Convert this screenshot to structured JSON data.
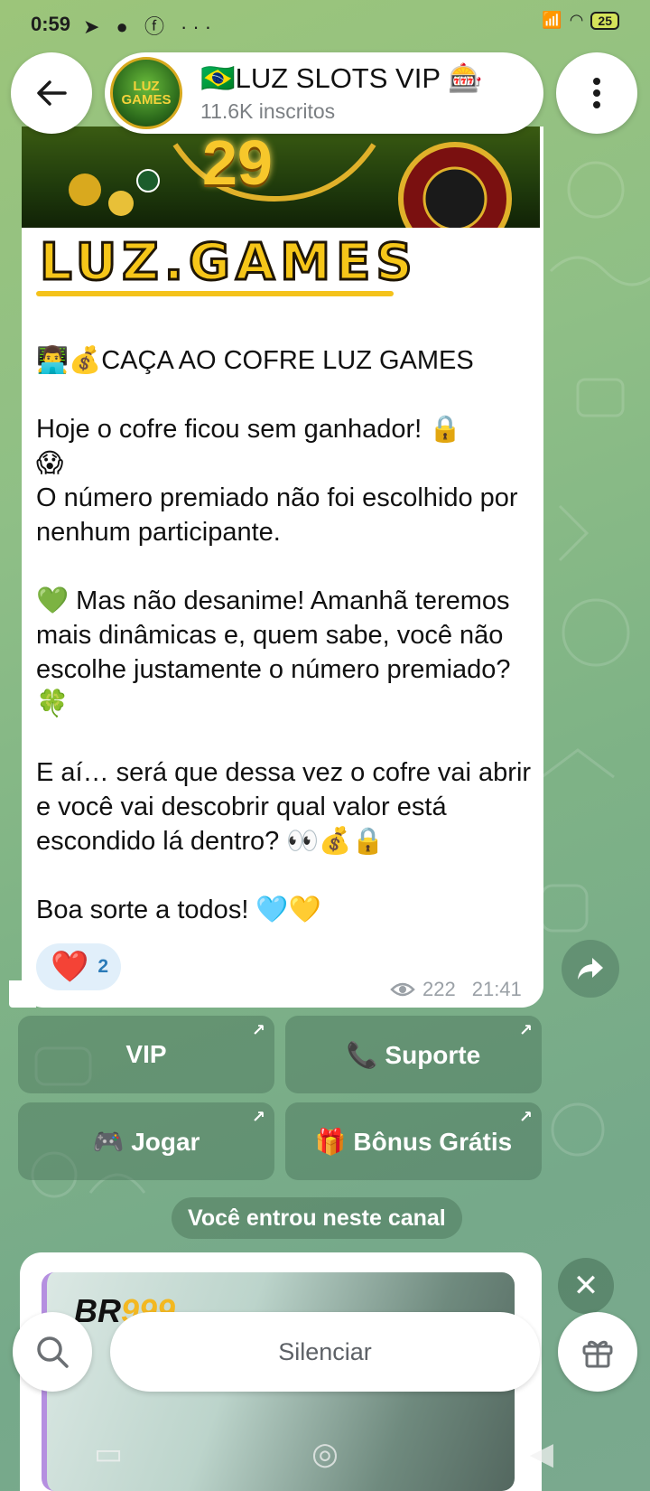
{
  "status_bar": {
    "time": "0:59",
    "battery": "25"
  },
  "header": {
    "title": "🇧🇷LUZ SLOTS VIP 🎰",
    "subtitle": "11.6K inscritos",
    "avatar_text": "LUZ GAMES"
  },
  "message": {
    "banner_number": "29",
    "logo_text": "LUZ.GAMES",
    "paragraphs": [
      "👨‍💻💰CAÇA AO COFRE LUZ GAMES",
      "Hoje o cofre ficou sem ganhador! 🔒\n😱\nO número premiado não foi escolhido por nenhum participante.",
      "💚 Mas não desanime! Amanhã teremos mais dinâmicas e, quem sabe, você não escolhe justamente o número premiado? 🍀",
      "E aí… será que dessa vez o cofre vai abrir e você vai descobrir qual valor está escondido lá dentro? 👀💰🔒",
      "Boa sorte a todos! 🩵💛"
    ],
    "reaction_emoji": "❤️",
    "reaction_count": "2",
    "views": "222",
    "time": "21:41"
  },
  "buttons": {
    "vip": "VIP",
    "suporte": "📞 Suporte",
    "jogar": "🎮 Jogar",
    "bonus": "🎁 Bônus Grátis"
  },
  "service_message": "Você entrou neste canal",
  "ad": {
    "brand_left": "BR",
    "brand_right": "999"
  },
  "bottom": {
    "mute_label": "Silenciar"
  },
  "colors": {
    "accent": "#2a7ab8",
    "bubble": "#ffffff",
    "keyboard_button": "#467055"
  }
}
